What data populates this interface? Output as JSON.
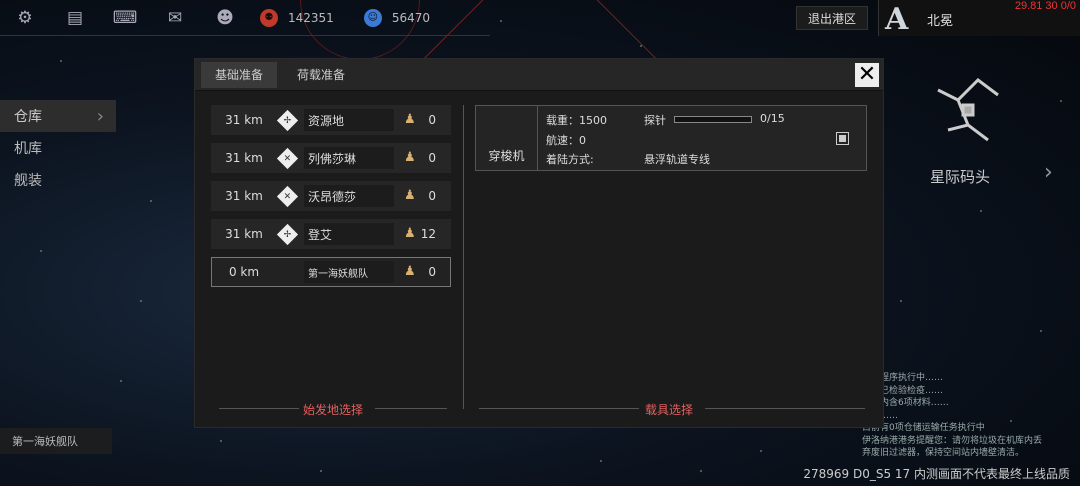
{
  "topbar": {
    "icons": [
      "gear-icon",
      "chat-icon",
      "keyboard-icon",
      "mail-icon",
      "user-icon"
    ],
    "resources": [
      {
        "icon": "credits-icon",
        "value": "142351",
        "color": "#c0392b"
      },
      {
        "icon": "crystal-icon",
        "value": "56470",
        "color": "#3b7bd6"
      }
    ],
    "exit_label": "退出港区",
    "logo_letter": "A",
    "player_name": "北冕",
    "fps_text": "29.81 30 0/0"
  },
  "leftmenu": {
    "items": [
      {
        "label": "仓库",
        "active": true
      },
      {
        "label": "机库",
        "active": false
      },
      {
        "label": "舰装",
        "active": false
      }
    ],
    "fleet_tag": "第一海妖舰队"
  },
  "right": {
    "dock_label": "星际码头",
    "log_lines": [
      "系统程序执行中……",
      "物品已检验检疫……",
      "仓库内含6项材料……",
      "就绪……",
      "目前有0项仓储运输任务执行中",
      "伊洛纳港港务提醒您：请勿将垃圾在机库内丢",
      "弃废旧过滤器，保持空间站内墙壁清洁。"
    ],
    "footer": "278969 D0_S5 17  内测画面不代表最终上线品质"
  },
  "modal": {
    "tabs": [
      {
        "label": "基础准备",
        "active": true
      },
      {
        "label": "荷载准备",
        "active": false
      }
    ],
    "destinations": [
      {
        "distance": "31 km",
        "name": "资源地",
        "count": "0",
        "selected": false
      },
      {
        "distance": "31 km",
        "name": "列佛莎琳",
        "count": "0",
        "selected": false
      },
      {
        "distance": "31 km",
        "name": "沃昂德莎",
        "count": "0",
        "selected": false
      },
      {
        "distance": "31 km",
        "name": "登艾",
        "count": "12",
        "selected": false
      },
      {
        "distance": "0 km",
        "name": "第一海妖舰队",
        "count": "0",
        "selected": true
      }
    ],
    "left_section_label": "始发地选择",
    "right_section_label": "载具选择",
    "vehicle": {
      "name": "穿梭机",
      "load_label": "载重：1500",
      "speed_label": "航速：0",
      "landing_label": "着陆方式:",
      "probe_label": "探针",
      "probe_value": "0/15",
      "probe_fraction": 0.0,
      "landing_value": "悬浮轨道专线"
    }
  }
}
